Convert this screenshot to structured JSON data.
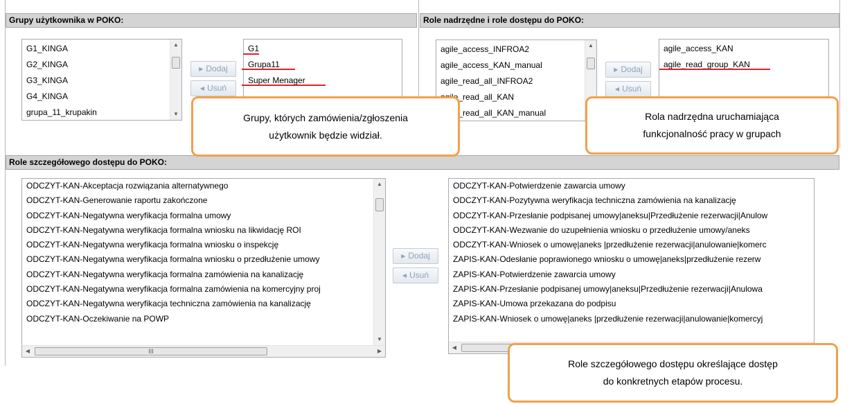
{
  "panels": {
    "groups": {
      "header": "Grupy użytkownika w POKO:",
      "available": [
        "G1_KINGA",
        "G2_KINGA",
        "G3_KINGA",
        "G4_KINGA",
        "grupa_11_krupakin"
      ],
      "selected": [
        "G1",
        "Grupa11",
        "Super Menager"
      ],
      "add_label": "Dodaj",
      "remove_label": "Usuń"
    },
    "roles": {
      "header": "Role nadrzędne i role dostępu do POKO:",
      "available": [
        "agile_access_INFROA2",
        "agile_access_KAN_manual",
        "agile_read_all_INFROA2",
        "agile_read_all_KAN",
        "agile_read_all_KAN_manual"
      ],
      "selected": [
        "agile_access_KAN",
        "agile_read_group_KAN"
      ],
      "add_label": "Dodaj",
      "remove_label": "Usuń"
    },
    "detailed": {
      "header": "Role szczegółowego dostępu do POKO:",
      "available": [
        "ODCZYT-KAN-Akceptacja rozwiązania alternatywnego",
        "ODCZYT-KAN-Generowanie raportu zakończone",
        "ODCZYT-KAN-Negatywna weryfikacja formalna umowy",
        "ODCZYT-KAN-Negatywna weryfikacja formalna wniosku na likwidację ROI",
        "ODCZYT-KAN-Negatywna weryfikacja formalna wniosku o inspekcję",
        "ODCZYT-KAN-Negatywna weryfikacja formalna wniosku o przedłużenie umowy",
        "ODCZYT-KAN-Negatywna weryfikacja formalna zamówienia na kanalizację",
        "ODCZYT-KAN-Negatywna weryfikacja formalna zamówienia na komercyjny proj",
        "ODCZYT-KAN-Negatywna weryfikacja techniczna zamówienia na kanalizację",
        "ODCZYT-KAN-Oczekiwanie na POWP"
      ],
      "selected": [
        "ODCZYT-KAN-Potwierdzenie zawarcia umowy",
        "ODCZYT-KAN-Pozytywna weryfikacja techniczna zamówienia na kanalizację",
        "ODCZYT-KAN-Przesłanie podpisanej umowy|aneksu|Przedłużenie rezerwacji|Anulow",
        "ODCZYT-KAN-Wezwanie do uzupełnienia wniosku o przedłużenie umowy/aneks",
        "ODCZYT-KAN-Wniosek o umowę|aneks |przedłużenie rezerwacji|anulowanie|komerc",
        "ZAPIS-KAN-Odesłanie poprawionego wniosku o umowę|aneks|przedłużenie rezerw",
        "ZAPIS-KAN-Potwierdzenie zawarcia umowy",
        "ZAPIS-KAN-Przesłanie podpisanej umowy|aneksu|Przedłużenie rezerwacji|Anulowa",
        "ZAPIS-KAN-Umowa przekazana do podpisu",
        "ZAPIS-KAN-Wniosek o umowę|aneks |przedłużenie rezerwacji|anulowanie|komercyj"
      ],
      "add_label": "Dodaj",
      "remove_label": "Usuń",
      "hscroll_grip": "III"
    }
  },
  "callouts": {
    "groups": [
      "Grupy, których zamówienia/zgłoszenia",
      "użytkownik będzie widział."
    ],
    "roles": [
      "Rola nadrzędna uruchamiająca",
      "funkcjonalność pracy w grupach"
    ],
    "detailed": [
      "Role szczegółowego dostępu określające dostęp",
      "do konkretnych etapów procesu."
    ]
  },
  "colors": {
    "annotation_border": "#f0a04c",
    "underline": "#e0202a",
    "header_bg": "#d4d4d4",
    "button_text": "#8fa3bb"
  },
  "icons": {
    "add": "triangle-right-icon",
    "remove": "triangle-left-icon",
    "scroll_up": "arrow-up-icon",
    "scroll_down": "arrow-down-icon",
    "scroll_left": "arrow-left-icon",
    "scroll_right": "arrow-right-icon"
  }
}
